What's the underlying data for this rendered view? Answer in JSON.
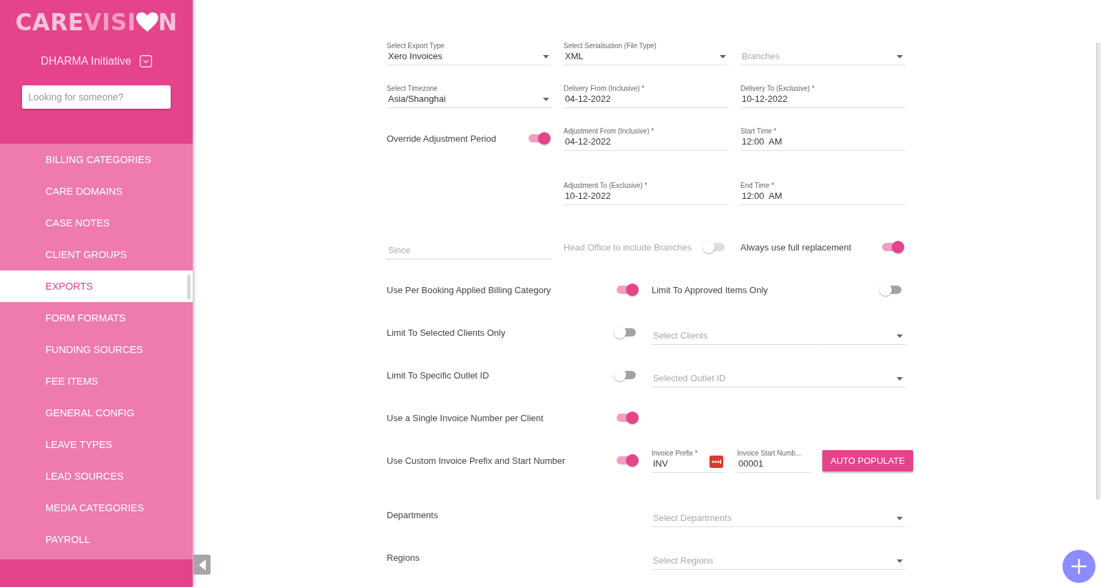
{
  "sidebar": {
    "logo": {
      "first": "CARE",
      "second": "VISI",
      "last": "N"
    },
    "org": "DHARMA Initiative",
    "search": {
      "placeholder": "Looking for someone?"
    },
    "items": [
      {
        "label": "BILLING CATEGORIES",
        "selected": false
      },
      {
        "label": "CARE DOMAINS",
        "selected": false
      },
      {
        "label": "CASE NOTES",
        "selected": false
      },
      {
        "label": "CLIENT GROUPS",
        "selected": false
      },
      {
        "label": "EXPORTS",
        "selected": true
      },
      {
        "label": "FORM FORMATS",
        "selected": false
      },
      {
        "label": "FUNDING SOURCES",
        "selected": false
      },
      {
        "label": "FEE ITEMS",
        "selected": false
      },
      {
        "label": "GENERAL CONFIG",
        "selected": false
      },
      {
        "label": "LEAVE TYPES",
        "selected": false
      },
      {
        "label": "LEAD SOURCES",
        "selected": false
      },
      {
        "label": "MEDIA CATEGORIES",
        "selected": false
      },
      {
        "label": "PAYROLL",
        "selected": false
      }
    ]
  },
  "form": {
    "sections": [
      {
        "rows": [
          {
            "kind": "thirds",
            "cells": [
              {
                "kind": "select",
                "label": "Select Export Type",
                "value": "Xero Invoices",
                "disabled": false
              },
              {
                "kind": "select",
                "label": "Select Serialisation (File Type)",
                "value": "XML",
                "disabled": false
              },
              {
                "kind": "select",
                "placeholder": "Branches",
                "disabled": false
              }
            ]
          },
          {
            "kind": "thirds",
            "cells": [
              {
                "kind": "select",
                "label": "Select Timezone",
                "value": "Asia/Shanghai",
                "disabled": false
              },
              {
                "kind": "input",
                "label": "Delivery From (Inclusive) *",
                "value": "04-12-2022",
                "disabled": false
              },
              {
                "kind": "input",
                "label": "Delivery To (Exclusive) *",
                "value": "10-12-2022",
                "disabled": false
              }
            ]
          },
          {
            "kind": "thirds",
            "cells": [
              {
                "kind": "toggle",
                "label": "Override Adjustment Period",
                "on": true,
                "disabled": false
              },
              {
                "kind": "input",
                "label": "Adjustment From (Inclusive) *",
                "value": "04-12-2022",
                "disabled": false
              },
              {
                "kind": "input",
                "label": "Start Time *",
                "value": "12:00  AM",
                "disabled": false
              }
            ]
          }
        ]
      },
      {
        "rows": [
          {
            "kind": "thirds",
            "cells": [
              {
                "kind": "blank"
              },
              {
                "kind": "input",
                "label": "Adjustment To (Exclusive) *",
                "value": "10-12-2022",
                "disabled": false
              },
              {
                "kind": "input",
                "label": "End Time *",
                "value": "12:00  AM",
                "disabled": false
              }
            ]
          }
        ]
      },
      {
        "rows": [
          {
            "kind": "thirds",
            "cells": [
              {
                "kind": "input",
                "placeholder": "Since",
                "disabled": true
              },
              {
                "kind": "toggle",
                "label": "Head Office to include Branches",
                "on": false,
                "disabled": true
              },
              {
                "kind": "toggle",
                "label": "Always use full replacement",
                "on": true,
                "disabled": false
              }
            ]
          },
          {
            "kind": "halves",
            "cells": [
              {
                "kind": "toggle",
                "label": "Use Per Booking Applied Billing Category",
                "on": true,
                "disabled": false
              },
              {
                "kind": "toggle",
                "label": "Limit To Approved Items Only",
                "on": false,
                "disabled": false
              }
            ]
          },
          {
            "kind": "halves",
            "cells": [
              {
                "kind": "toggle",
                "label": "Limit To Selected Clients Only",
                "on": false,
                "disabled": false
              },
              {
                "kind": "select",
                "placeholder": "Select Clients",
                "disabled": true
              }
            ]
          },
          {
            "kind": "halves",
            "cells": [
              {
                "kind": "toggle",
                "label": "Limit To Specific Outlet ID",
                "on": false,
                "disabled": false
              },
              {
                "kind": "select",
                "placeholder": "Selected Outlet ID",
                "disabled": true
              }
            ]
          },
          {
            "kind": "halves",
            "cells": [
              {
                "kind": "toggle",
                "label": "Use a Single Invoice Number per Client",
                "on": true,
                "disabled": false
              }
            ]
          },
          {
            "kind": "halves",
            "cells": [
              {
                "kind": "toggle",
                "label": "Use Custom Invoice Prefix and Start Number",
                "on": true,
                "disabled": false
              },
              {
                "kind": "secure-input",
                "label": "Invoice Prefix *",
                "value": "INV",
                "disabled": false
              },
              {
                "kind": "input",
                "label": "Invoice Start Numb...",
                "value": "00001",
                "disabled": false
              },
              {
                "kind": "button",
                "label": "AUTO POPULATE"
              }
            ]
          }
        ]
      },
      {
        "rows": [
          {
            "kind": "halves",
            "cells": [
              {
                "kind": "label",
                "text": "Departments"
              },
              {
                "kind": "select",
                "placeholder": "Select Departments",
                "disabled": false
              }
            ]
          },
          {
            "kind": "halves",
            "cells": [
              {
                "kind": "label",
                "text": "Regions"
              },
              {
                "kind": "select",
                "placeholder": "Select Regions",
                "disabled": false
              }
            ]
          }
        ]
      }
    ]
  }
}
